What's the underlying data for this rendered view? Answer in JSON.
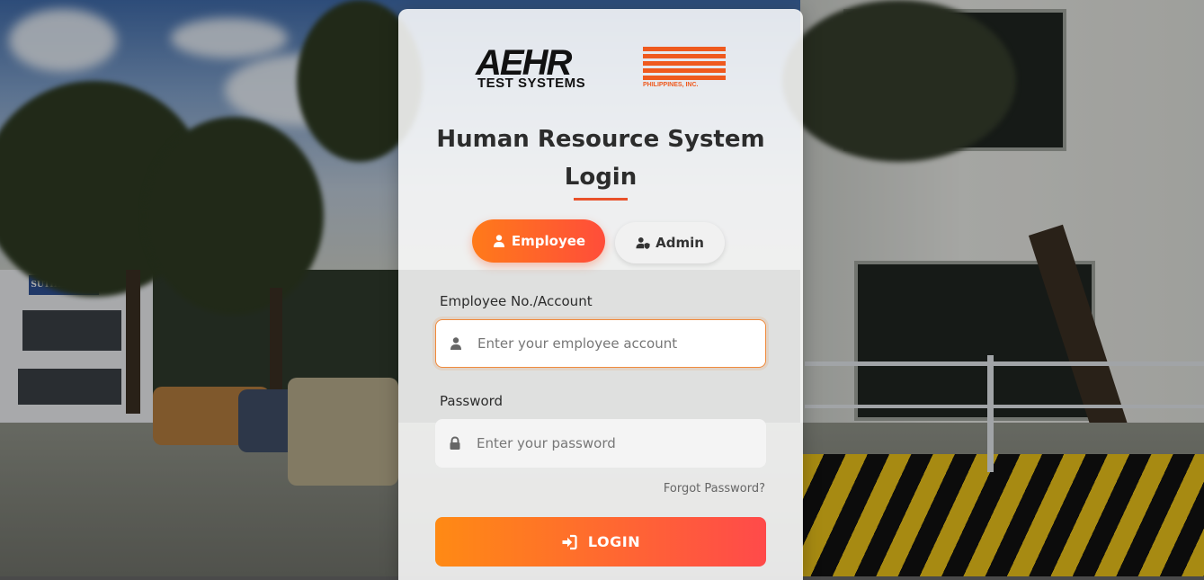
{
  "logo": {
    "brand": "AEHR",
    "tagline": "TEST SYSTEMS",
    "subtitle": "PHILIPPINES, INC."
  },
  "background": {
    "building_sign": "SUTHERLAND"
  },
  "login": {
    "title_line1": "Human Resource System",
    "title_line2": "Login",
    "roles": [
      {
        "label": "Employee",
        "icon": "user-icon",
        "active": true
      },
      {
        "label": "Admin",
        "icon": "user-shield-icon",
        "active": false
      }
    ],
    "account_label": "Employee No./Account",
    "account_placeholder": "Enter your employee account",
    "account_value": "",
    "password_label": "Password",
    "password_placeholder": "Enter your password",
    "password_value": "",
    "forgot_link": "Forgot Password?",
    "submit_label": "LOGIN",
    "submit_icon": "sign-in-icon"
  },
  "colors": {
    "accent_start": "#ff8a14",
    "accent_end": "#ff4a4a",
    "title_underline": "#e8512a"
  }
}
